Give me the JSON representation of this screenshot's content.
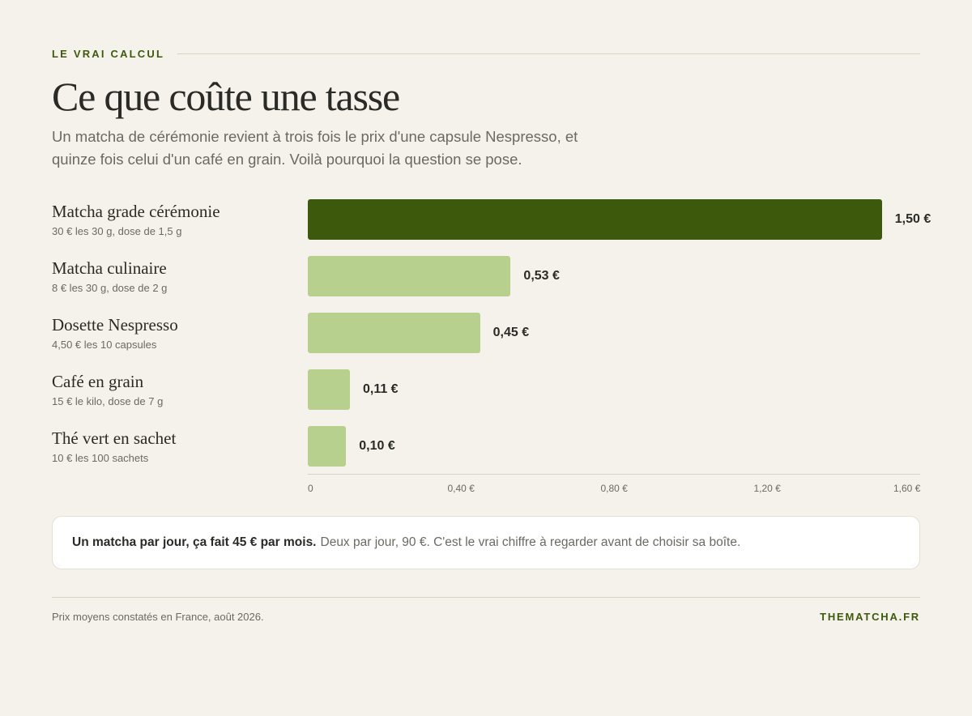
{
  "eyebrow": "LE VRAI CALCUL",
  "title": "Ce que coûte une tasse",
  "subtitle": "Un matcha de cérémonie revient à trois fois le prix d'une capsule Nespresso, et quinze fois celui d'un café en grain. Voilà pourquoi la question se pose.",
  "colors": {
    "highlight": "#3d5a0c",
    "default": "#b8d08e"
  },
  "chart_data": {
    "type": "bar",
    "orientation": "horizontal",
    "categories": [
      "Matcha grade cérémonie",
      "Matcha culinaire",
      "Dosette Nespresso",
      "Café en grain",
      "Thé vert en sachet"
    ],
    "notes": [
      "30 € les 30 g, dose de 1,5 g",
      "8 € les 30 g, dose de 2 g",
      "4,50 € les 10 capsules",
      "15 € le kilo, dose de 7 g",
      "10 € les 100 sachets"
    ],
    "values": [
      1.5,
      0.53,
      0.45,
      0.11,
      0.1
    ],
    "value_labels": [
      "1,50 €",
      "0,53 €",
      "0,45 €",
      "0,11 €",
      "0,10 €"
    ],
    "highlighted": [
      true,
      false,
      false,
      false,
      false
    ],
    "xlim": [
      0,
      1.6
    ],
    "xticks": [
      0,
      0.4,
      0.8,
      1.2,
      1.6
    ],
    "xtick_labels": [
      "0",
      "0,40 €",
      "0,80 €",
      "1,20 €",
      "1,60 €"
    ],
    "grid": false
  },
  "callout": {
    "strong": "Un matcha par jour, ça fait 45 € par mois.",
    "rest": "Deux par jour, 90 €. C'est le vrai chiffre à regarder avant de choisir sa boîte."
  },
  "footer": {
    "source": "Prix moyens constatés en France, août 2026.",
    "brand": "THEMATCHA.FR"
  }
}
